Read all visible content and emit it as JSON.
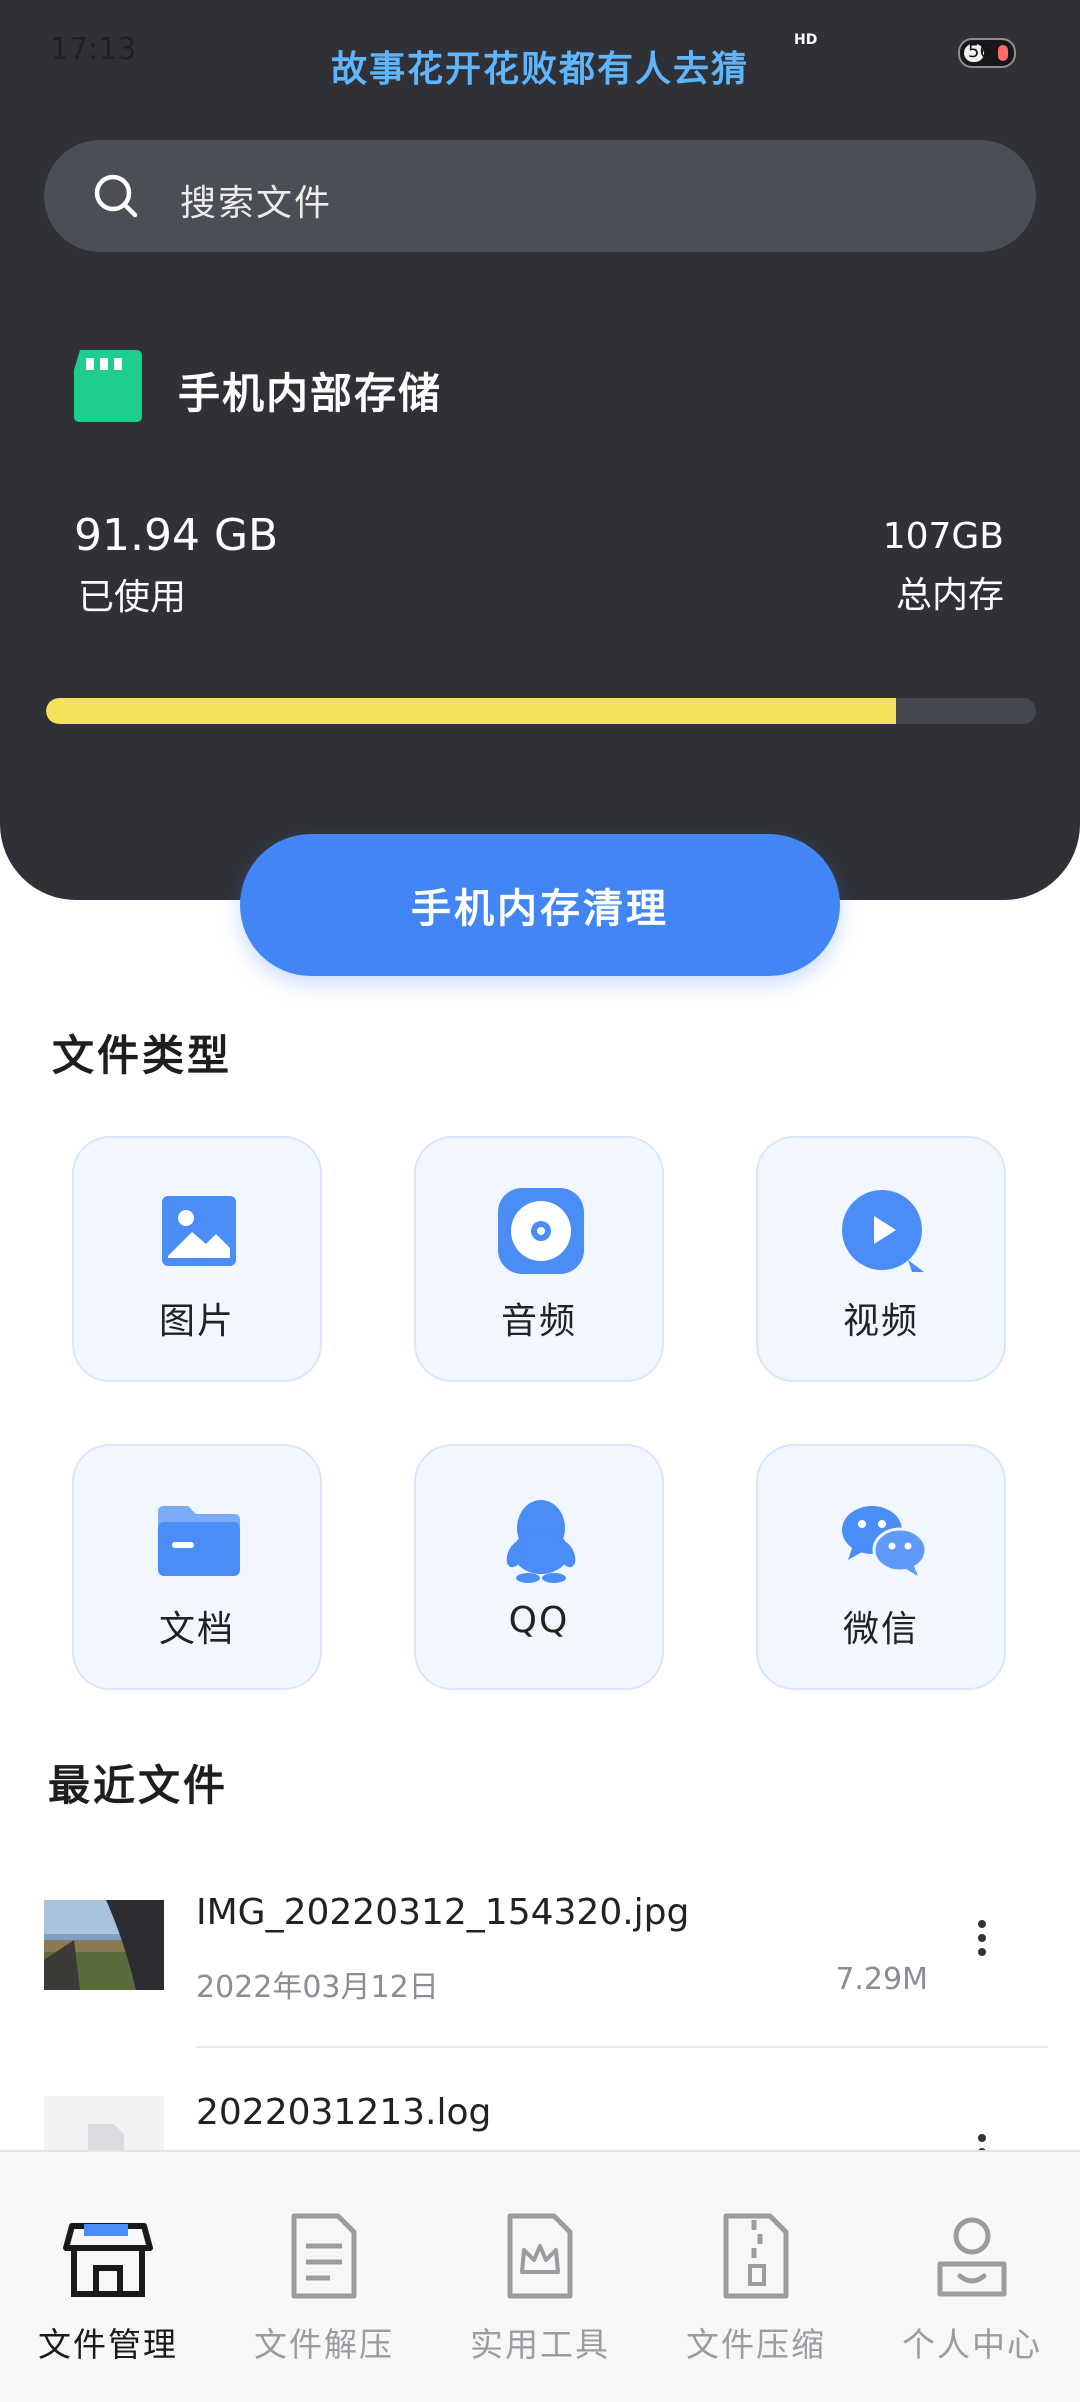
{
  "status_bar": {
    "time": "17:13",
    "motto": "故事花开花败都有人去猜",
    "hd": "HD",
    "battery": "56"
  },
  "search": {
    "placeholder": "搜索文件",
    "icon": "search-icon"
  },
  "storage": {
    "title": "手机内部存储",
    "used_value": "91.94 GB",
    "used_label": "已使用",
    "total_value": "107GB",
    "total_label": "总内存",
    "usage_fraction": 0.859,
    "bar_color": "#f6e15c",
    "icon": "sd-card-icon"
  },
  "clean_button": {
    "label": "手机内存清理",
    "color": "#4285f4"
  },
  "file_types": {
    "title": "文件类型",
    "items": [
      {
        "label": "图片",
        "icon": "image-icon"
      },
      {
        "label": "音频",
        "icon": "audio-disc-icon"
      },
      {
        "label": "视频",
        "icon": "video-play-icon"
      },
      {
        "label": "文档",
        "icon": "folder-icon"
      },
      {
        "label": "QQ",
        "icon": "qq-penguin-icon"
      },
      {
        "label": "微信",
        "icon": "wechat-icon"
      }
    ]
  },
  "recent": {
    "title": "最近文件",
    "files": [
      {
        "name": "IMG_20220312_154320.jpg",
        "date": "2022年03月12日",
        "size": "7.29M"
      },
      {
        "name": "2022031213.log",
        "date": "",
        "size": ""
      }
    ]
  },
  "tabbar": {
    "active_color": "#1a1a1a",
    "inactive_color": "#9a9ca1",
    "items": [
      {
        "label": "文件管理",
        "icon": "store-icon",
        "active": true
      },
      {
        "label": "文件解压",
        "icon": "document-icon",
        "active": false
      },
      {
        "label": "实用工具",
        "icon": "crown-doc-icon",
        "active": false
      },
      {
        "label": "文件压缩",
        "icon": "zip-file-icon",
        "active": false
      },
      {
        "label": "个人中心",
        "icon": "user-icon",
        "active": false
      }
    ]
  }
}
